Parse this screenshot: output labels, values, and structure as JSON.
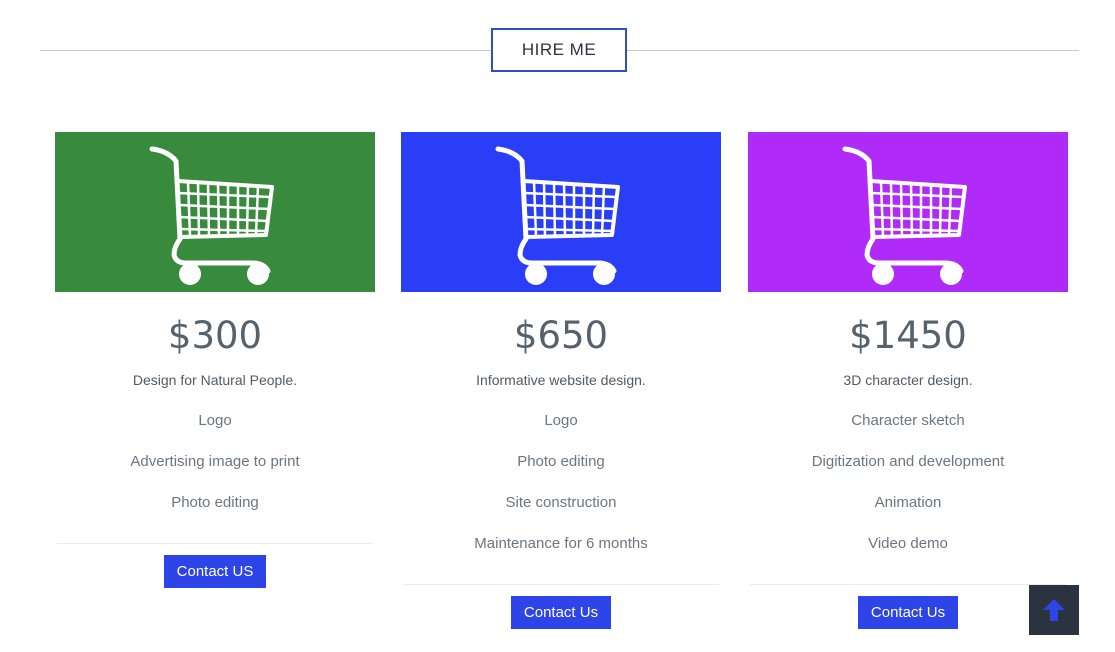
{
  "section": {
    "title": "HIRE ME"
  },
  "plans": [
    {
      "banner_color": "#388a3d",
      "icon": "shopping-cart-icon",
      "price": "$300",
      "subtitle": "Design for Natural People.",
      "features": [
        "Logo",
        "Advertising image to print",
        "Photo editing"
      ],
      "button_label": "Contact US"
    },
    {
      "banner_color": "#2a3ef8",
      "icon": "shopping-cart-icon",
      "price": "$650",
      "subtitle": "Informative website design.",
      "features": [
        "Logo",
        "Photo editing",
        "Site construction",
        "Maintenance for 6 months"
      ],
      "button_label": "Contact Us"
    },
    {
      "banner_color": "#b12bf8",
      "icon": "shopping-cart-icon",
      "price": "$1450",
      "subtitle": "3D character design.",
      "features": [
        "Character sketch",
        "Digitization and development",
        "Animation",
        "Video demo"
      ],
      "button_label": "Contact Us"
    }
  ],
  "colors": {
    "accent": "#2d44e8",
    "back_to_top_bg": "#2b3340",
    "back_to_top_arrow": "#2d44e8"
  },
  "back_to_top": {
    "icon": "arrow-up-icon"
  }
}
